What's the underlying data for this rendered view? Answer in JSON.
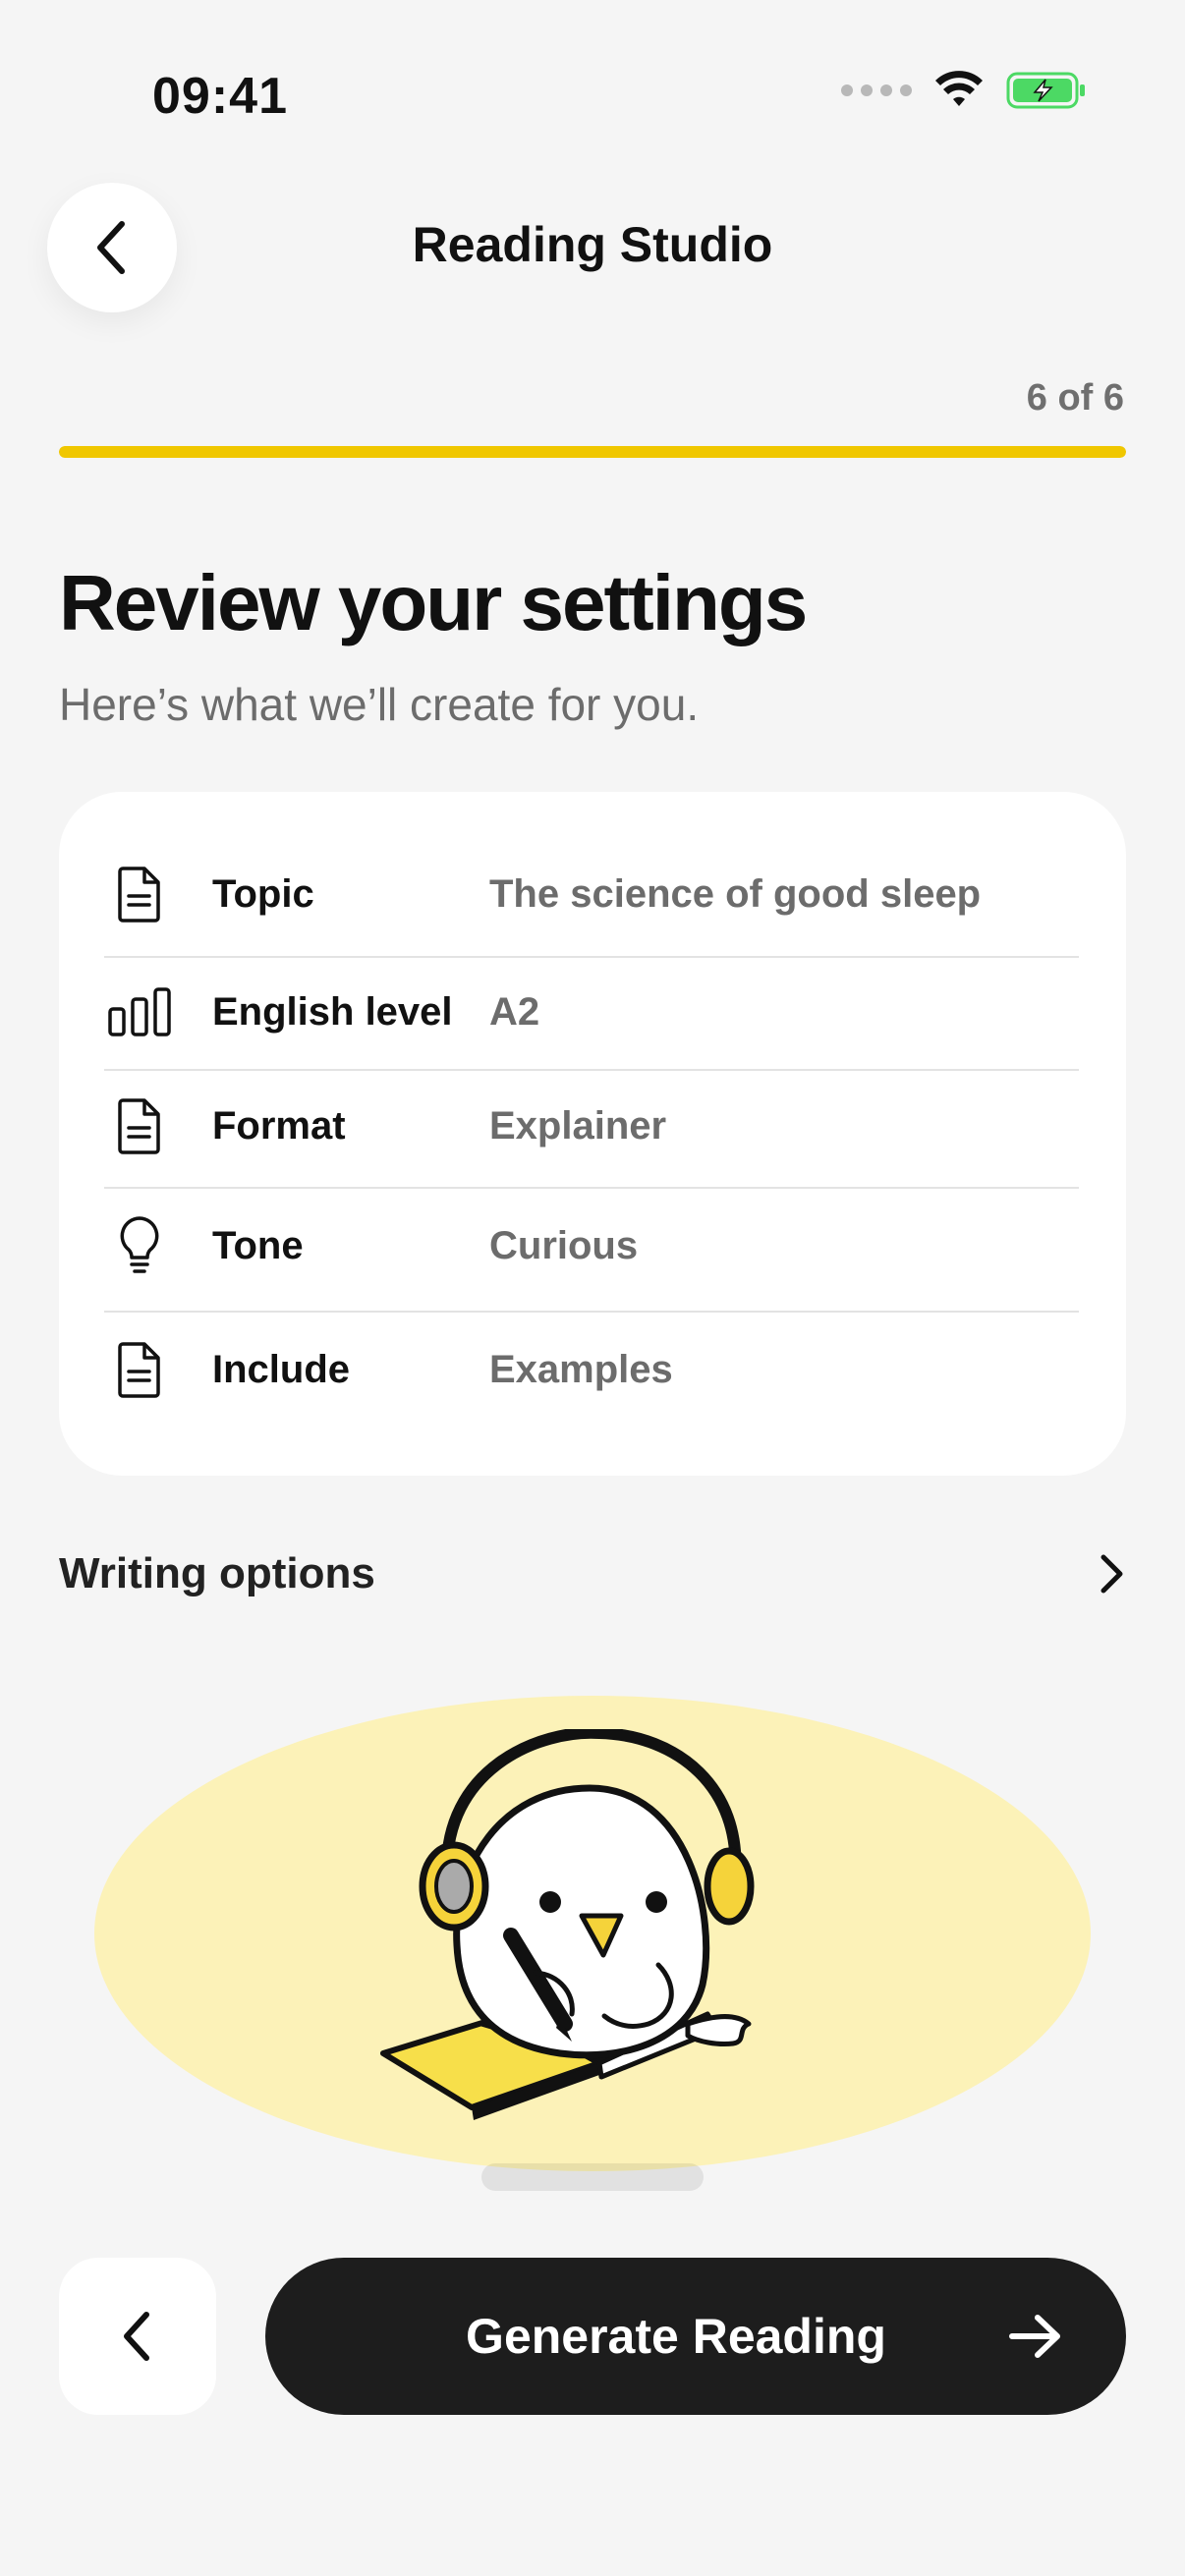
{
  "status_bar": {
    "time": "09:41",
    "icons": [
      "signal-dots-icon",
      "wifi-icon",
      "battery-charging-icon"
    ],
    "battery_color": "#4cd964"
  },
  "header": {
    "title": "Reading Studio",
    "back_icon": "chevron-left-icon"
  },
  "progress": {
    "step_label": "6 of 6",
    "fraction": 1.0,
    "color": "#f0c700"
  },
  "intro": {
    "title": "Review your settings",
    "subtitle": "Here’s what we’ll create for you."
  },
  "settings": [
    {
      "icon": "document-icon",
      "label": "Topic",
      "value": "The science of good sleep"
    },
    {
      "icon": "bar-chart-icon",
      "label": "English level",
      "value": "A2"
    },
    {
      "icon": "document-icon",
      "label": "Format",
      "value": "Explainer"
    },
    {
      "icon": "lightbulb-icon",
      "label": "Tone",
      "value": "Curious"
    },
    {
      "icon": "document-icon",
      "label": "Include",
      "value": "Examples"
    }
  ],
  "writing_options": {
    "label": "Writing options",
    "icon": "chevron-right-icon"
  },
  "illustration": {
    "subject": "bird-mascot-with-headphones-writing-icon",
    "background_color": "#fcf2b8"
  },
  "footer": {
    "back_icon": "chevron-left-icon",
    "generate_label": "Generate Reading",
    "generate_icon": "arrow-right-icon"
  }
}
